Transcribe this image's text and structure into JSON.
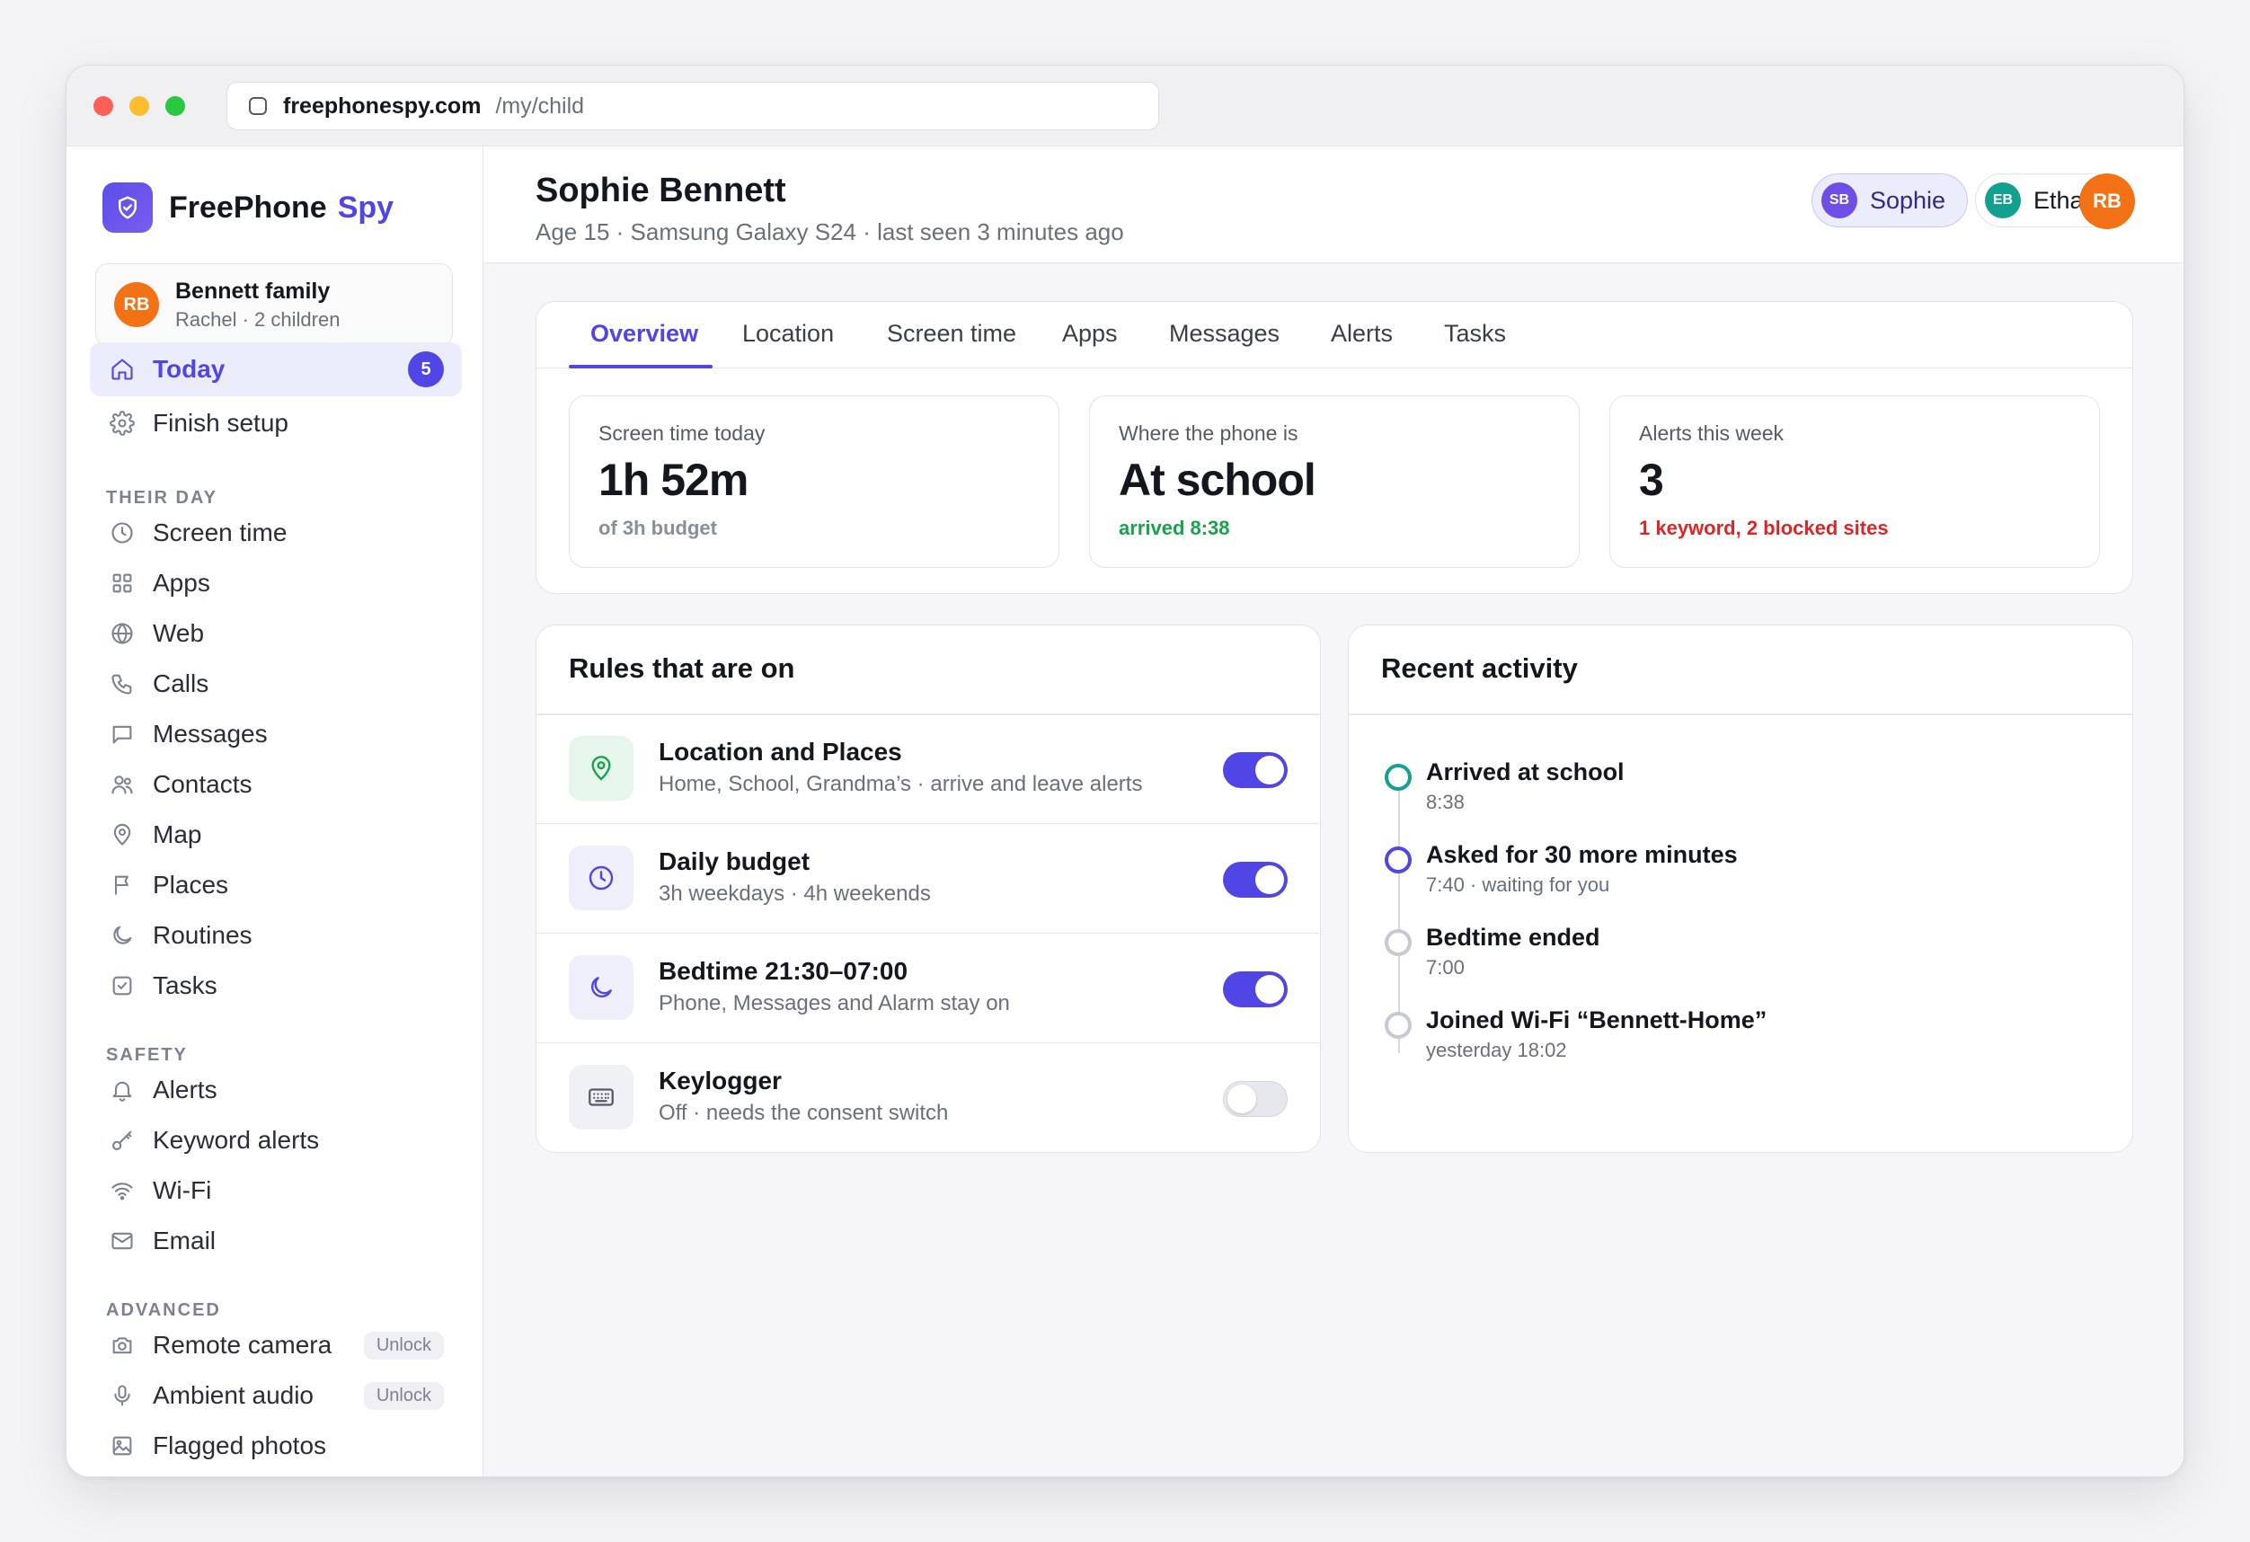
{
  "browser": {
    "domain": "freephonespy.com",
    "path": "/my/child"
  },
  "brand": {
    "name": "FreePhone",
    "accent": "Spy",
    "accent_color": "#4f46e5"
  },
  "family": {
    "initials": "RB",
    "name": "Bennett family",
    "sub": "Rachel · 2 children"
  },
  "nav": {
    "top": [
      {
        "label": "Today",
        "icon": "home-icon",
        "badge": "5",
        "active": true
      },
      {
        "label": "Finish setup",
        "icon": "gear-icon"
      }
    ],
    "sections": [
      {
        "label": "THEIR DAY",
        "items": [
          "Screen time",
          "Apps",
          "Web",
          "Calls",
          "Messages",
          "Contacts",
          "Map",
          "Places",
          "Routines",
          "Tasks"
        ]
      },
      {
        "label": "SAFETY",
        "items": [
          "Alerts",
          "Keyword alerts",
          "Wi-Fi",
          "Email"
        ]
      },
      {
        "label": "ADVANCED",
        "items": [
          "Remote camera",
          "Ambient audio",
          "Flagged photos"
        ]
      }
    ],
    "unlock_label": "Unlock"
  },
  "header": {
    "name": "Sophie Bennett",
    "sub": "Age 15 · Samsung Galaxy S24 · last seen 3 minutes ago",
    "children": [
      {
        "initials": "SB",
        "name": "Sophie",
        "color": "#6d4ee6",
        "active": true
      },
      {
        "initials": "EB",
        "name": "Ethan",
        "color": "#14a08f"
      }
    ],
    "user_initials": "RB"
  },
  "tabs": [
    "Overview",
    "Location",
    "Screen time",
    "Apps",
    "Messages",
    "Alerts",
    "Tasks"
  ],
  "stats": [
    {
      "label": "Screen time today",
      "value": "1h 52m",
      "sub": "of 3h budget",
      "sub_color": "#8a8e9b"
    },
    {
      "label": "Where the phone is",
      "value": "At school",
      "sub": "arrived 8:38",
      "sub_color": "#16a34a"
    },
    {
      "label": "Alerts this week",
      "value": "3",
      "sub": "1 keyword, 2 blocked sites",
      "sub_color": "#dc2626"
    }
  ],
  "rules": {
    "title": "Rules that are on",
    "items": [
      {
        "title": "Location and Places",
        "sub": "Home, School, Grandma’s · arrive and leave alerts",
        "icon": "map-pin-icon",
        "on": true
      },
      {
        "title": "Daily budget",
        "sub": "3h weekdays · 4h weekends",
        "icon": "clock-icon",
        "on": true
      },
      {
        "title": "Bedtime 21:30–07:00",
        "sub": "Phone, Messages and Alarm stay on",
        "icon": "moon-icon",
        "on": true
      },
      {
        "title": "Keylogger",
        "sub": "Off · needs the consent switch",
        "icon": "keyboard-icon",
        "on": false
      }
    ]
  },
  "activity": {
    "title": "Recent activity",
    "items": [
      {
        "title": "Arrived at school",
        "sub": "8:38",
        "color": "#14a08f"
      },
      {
        "title": "Asked for 30 more minutes",
        "sub": "7:40 · waiting for you",
        "color": "#4f46e5"
      },
      {
        "title": "Bedtime ended",
        "sub": "7:00",
        "color": "#c6c9d2"
      },
      {
        "title": "Joined Wi-Fi “Bennett-Home”",
        "sub": "yesterday 18:02",
        "color": "#c6c9d2"
      }
    ]
  }
}
